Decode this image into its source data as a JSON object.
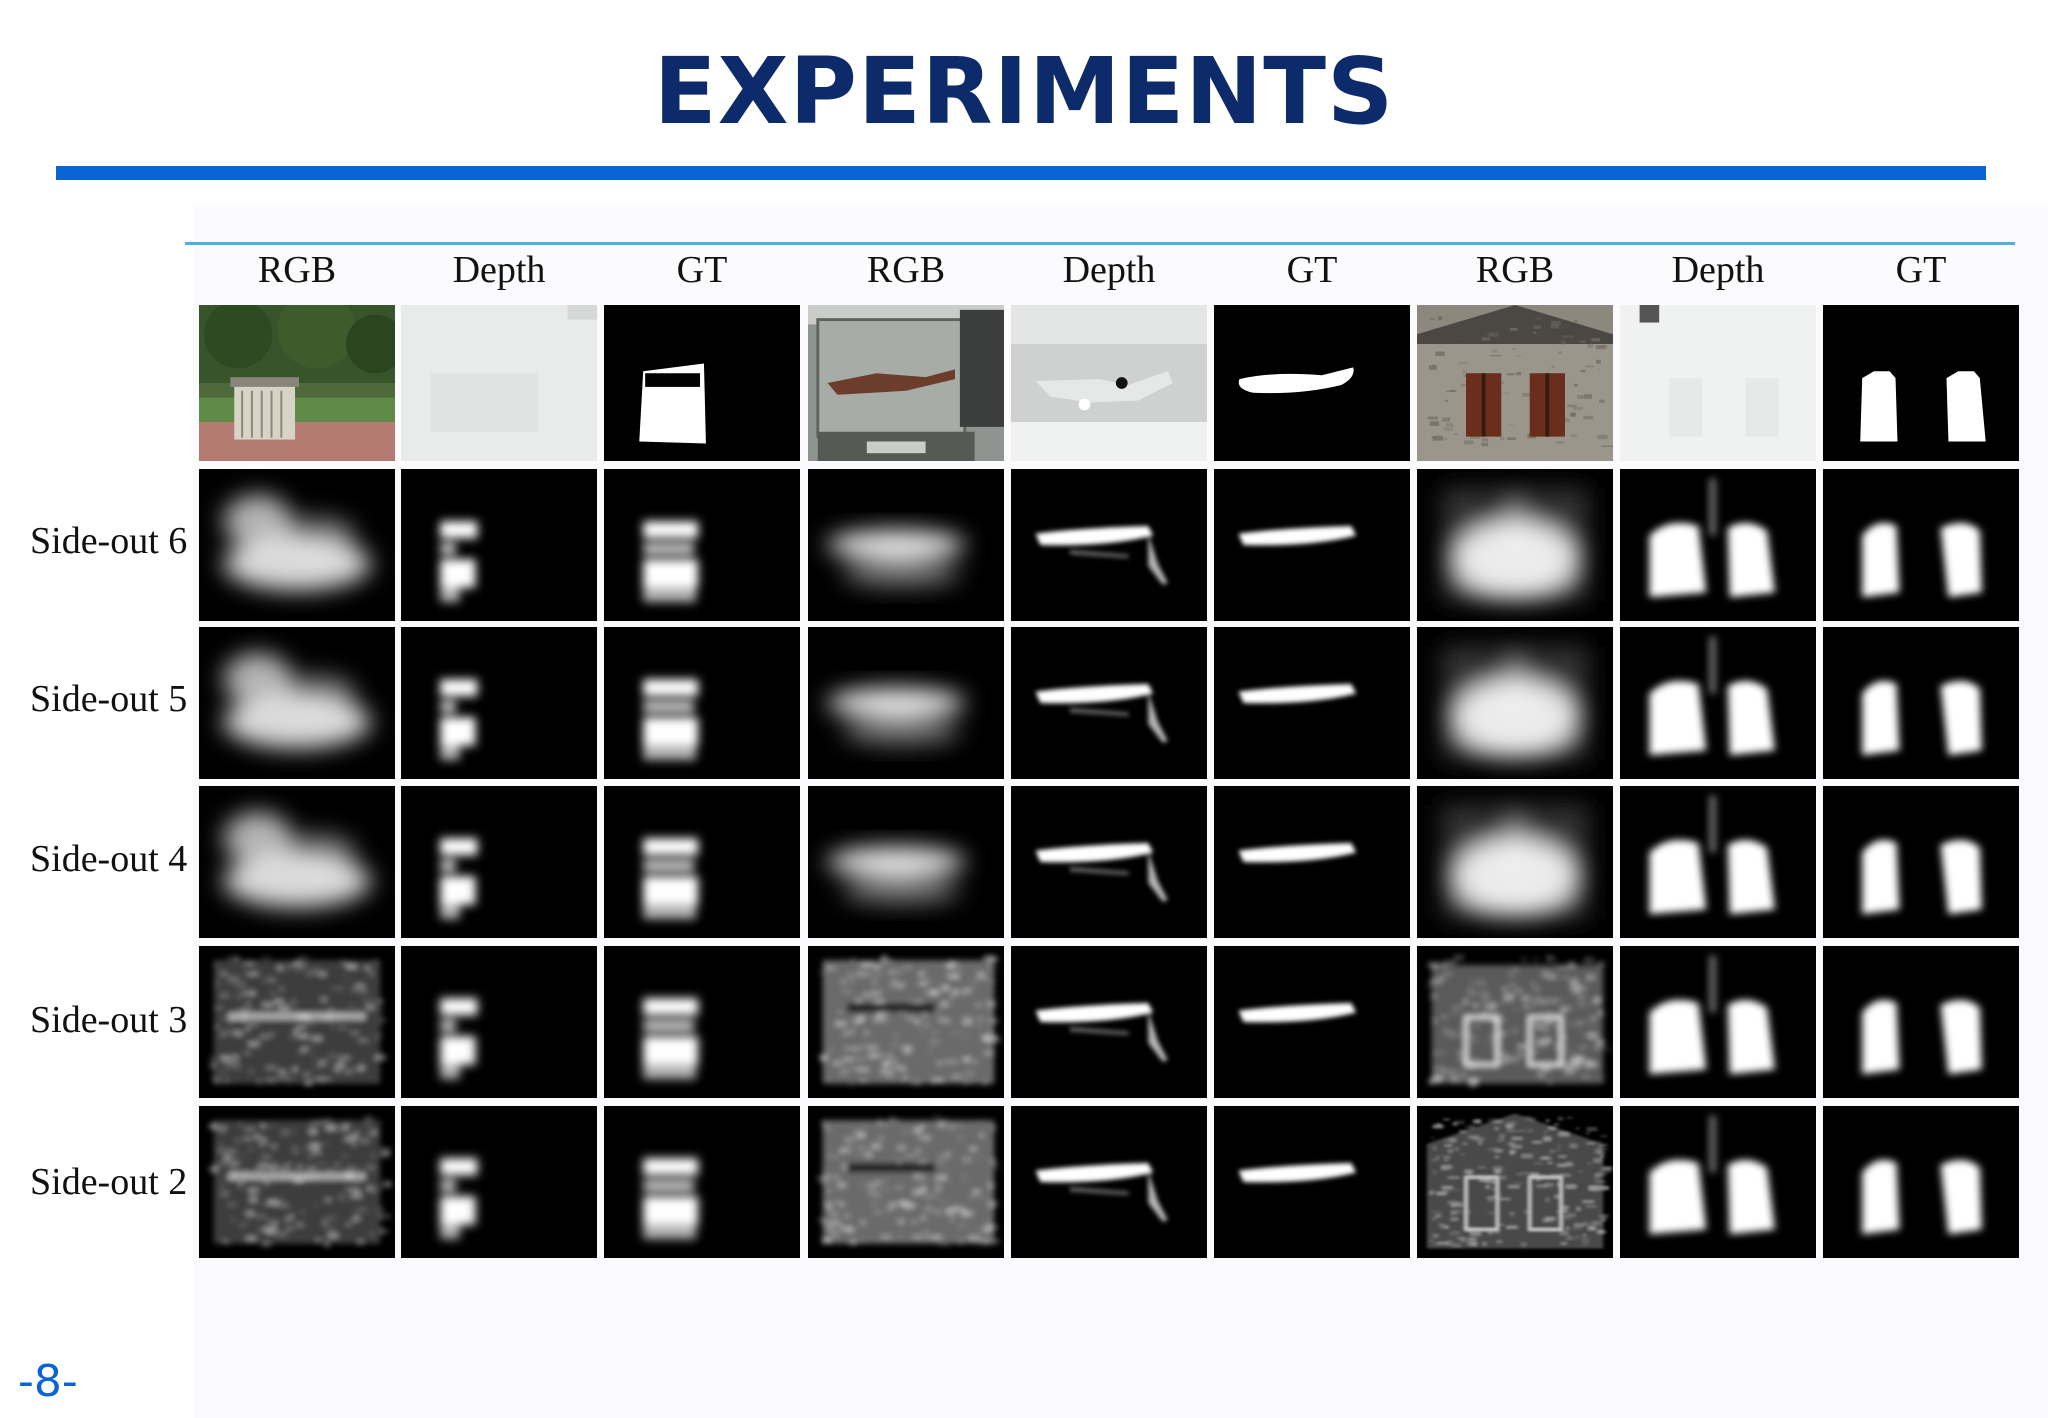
{
  "slide": {
    "title": "EXPERIMENTS",
    "page_number": "-8-"
  },
  "figure": {
    "column_headers": [
      "RGB",
      "Depth",
      "GT",
      "RGB",
      "Depth",
      "GT",
      "RGB",
      "Depth",
      "GT"
    ],
    "row_labels": [
      "",
      "Side-out 6",
      "Side-out 5",
      "Side-out 4",
      "Side-out 3",
      "Side-out 2"
    ],
    "accent_colors": {
      "title": "#0d2a6b",
      "rule": "#0a64d4",
      "figure_rule": "#4fb0dd"
    }
  }
}
